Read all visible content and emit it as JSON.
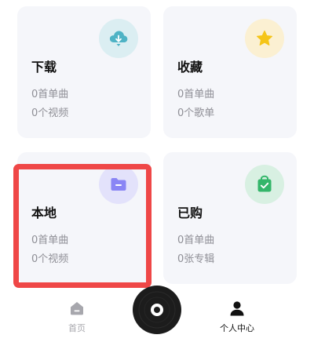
{
  "cards": {
    "download": {
      "title": "下载",
      "stat1": "0首单曲",
      "stat2": "0个视频",
      "icon": "cloud-download-icon",
      "icon_color": "#4fb3c5",
      "bubble_color": "#dbeef2"
    },
    "favorite": {
      "title": "收藏",
      "stat1": "0首单曲",
      "stat2": "0个歌单",
      "icon": "star-icon",
      "icon_color": "#f5c518",
      "bubble_color": "#fbf0d2"
    },
    "local": {
      "title": "本地",
      "stat1": "0首单曲",
      "stat2": "0个视频",
      "icon": "folder-icon",
      "icon_color": "#8a85f5",
      "bubble_color": "#e3e2fb"
    },
    "bought": {
      "title": "已购",
      "stat1": "0首单曲",
      "stat2": "0张专辑",
      "icon": "shopping-bag-icon",
      "icon_color": "#34b66a",
      "bubble_color": "#d8f0e2"
    }
  },
  "nav": {
    "home": {
      "label": "首页",
      "icon": "home-icon"
    },
    "profile": {
      "label": "个人中心",
      "icon": "user-icon"
    },
    "center": {
      "icon": "vinyl-disc-icon"
    }
  },
  "colors": {
    "highlight": "#ef4747",
    "card_bg": "#f5f6fa"
  }
}
